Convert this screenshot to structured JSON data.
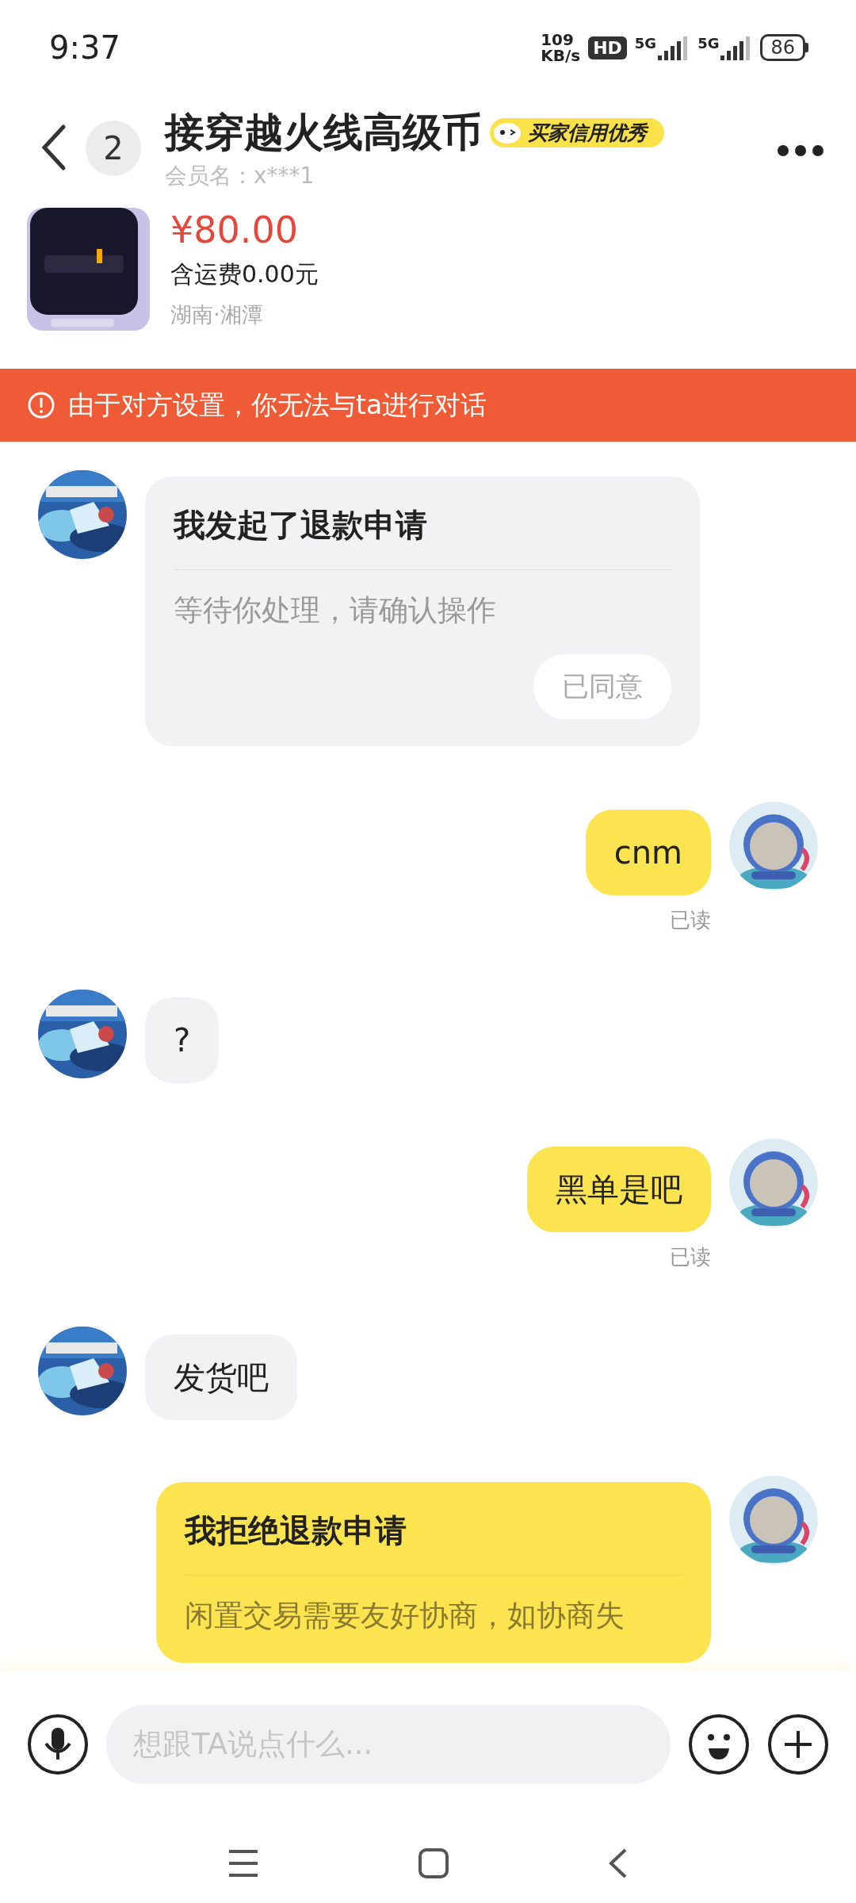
{
  "status_bar": {
    "time": "9:37",
    "net_speed": [
      "109",
      "KB/s"
    ],
    "hd_badge": "HD",
    "signals": [
      "5G",
      "5G"
    ],
    "battery": "86"
  },
  "header": {
    "unread_count": "2",
    "title": "接穿越火线高级币",
    "credit_badge": "买家信用优秀",
    "member": "会员名：x***1"
  },
  "product": {
    "price": "¥80.00",
    "shipping": "含运费0.00元",
    "location": "湖南·湘潭"
  },
  "notice": "由于对方设置，你无法与ta进行对话",
  "messages": [
    {
      "outgoing": false,
      "kind": "card",
      "title": "我发起了退款申请",
      "body": "等待你处理，请确认操作",
      "button": "已同意"
    },
    {
      "outgoing": true,
      "kind": "text",
      "text": "cnm",
      "read_status": "已读"
    },
    {
      "outgoing": false,
      "kind": "text",
      "text": "?"
    },
    {
      "outgoing": true,
      "kind": "text",
      "text": "黑单是吧",
      "read_status": "已读"
    },
    {
      "outgoing": false,
      "kind": "text",
      "text": "发货吧"
    },
    {
      "outgoing": true,
      "kind": "card",
      "title": "我拒绝退款申请",
      "body": "闲置交易需要友好协商，如协商失"
    }
  ],
  "composer": {
    "placeholder": "想跟TA说点什么..."
  }
}
